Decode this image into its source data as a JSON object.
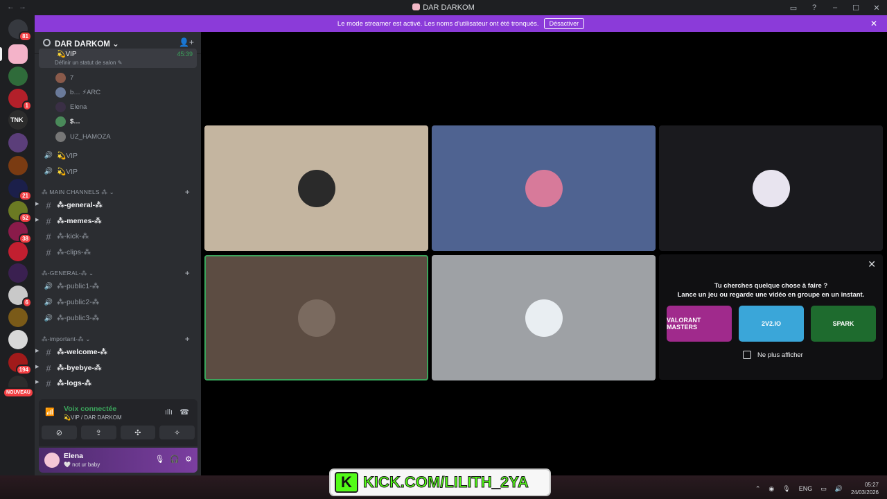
{
  "window": {
    "title": "DAR DARKOM",
    "nav_back": "←",
    "nav_forward": "→",
    "controls": [
      "▭",
      "?",
      "–",
      "☐",
      "✕"
    ]
  },
  "banner": {
    "message": "Le mode streamer est activé. Les noms d'utilisateur ont été tronqués.",
    "disable_label": "Désactiver",
    "close": "✕"
  },
  "rail": {
    "servers": [
      {
        "name": "dm",
        "color": "#36393f",
        "badge": "81"
      },
      {
        "name": "s1",
        "color": "#f4b3c9",
        "badge": "",
        "selected": true
      },
      {
        "name": "s2",
        "color": "#2f6b3a",
        "badge": ""
      },
      {
        "name": "s3",
        "color": "#b3202a",
        "badge": "1"
      },
      {
        "name": "s4",
        "color": "#2c2c2c",
        "badge": ""
      },
      {
        "name": "s5",
        "color": "#5b3e7a",
        "badge": ""
      },
      {
        "name": "s6",
        "color": "#7a3b12",
        "badge": ""
      },
      {
        "name": "s7",
        "color": "#1b1f4a",
        "badge": "21"
      },
      {
        "name": "s8",
        "color": "#6b7a23",
        "badge": "52"
      },
      {
        "name": "s9",
        "color": "#8a1b4a",
        "badge": "38"
      },
      {
        "name": "s10",
        "color": "#c21f30",
        "badge": ""
      },
      {
        "name": "s11",
        "color": "#3a2050",
        "badge": ""
      },
      {
        "name": "s12",
        "color": "#c9c9c9",
        "badge": "6"
      },
      {
        "name": "s13",
        "color": "#7a5a18",
        "badge": ""
      },
      {
        "name": "s14",
        "color": "#d8d8d8",
        "badge": ""
      },
      {
        "name": "s15",
        "color": "#a11a1a",
        "badge": "194"
      },
      {
        "name": "s16",
        "color": "#2c2c2c",
        "badge": "NOUVEAU"
      }
    ],
    "tnk_label": "TNK"
  },
  "sidebar": {
    "guild_name": "DAR DARKOM",
    "guild_chevron": "⌄",
    "invite_icon": "👤+",
    "vip_active": {
      "label": "💫VIP",
      "timer": "45:39",
      "status": "Définir un statut de salon ✎"
    },
    "voice_users": [
      {
        "name": "7",
        "color": "#8a5a4a",
        "bold": false
      },
      {
        "name": "b…  ⚡ARC",
        "color": "#6a7a9a",
        "bold": false
      },
      {
        "name": "Elena",
        "color": "#3a2f45",
        "bold": false
      },
      {
        "name": "$…",
        "color": "#4a8a5a",
        "bold": true
      },
      {
        "name": "UZ_HAMOZA",
        "color": "#777",
        "bold": false
      }
    ],
    "vip_channels": [
      "💫VIP",
      "💫VIP"
    ],
    "categories": [
      {
        "label": "⁂ MAIN CHANNELS ⁂ ⌄",
        "plus": "+"
      },
      {
        "label": "⁂-GENERAL-⁂ ⌄",
        "plus": "+"
      },
      {
        "label": "⁂-important-⁂ ⌄",
        "plus": "+"
      }
    ],
    "main_channels": [
      {
        "name": "⁂-general-⁂",
        "bright": true,
        "arrow": true
      },
      {
        "name": "⁂-memes-⁂",
        "bright": true,
        "arrow": true
      },
      {
        "name": "⁂-kick-⁂",
        "bright": false,
        "arrow": false
      },
      {
        "name": "⁂-clips-⁂",
        "bright": false,
        "arrow": false
      }
    ],
    "general_channels": [
      "⁂-public1-⁂",
      "⁂-public2-⁂",
      "⁂-public3-⁂"
    ],
    "important_channels": [
      {
        "name": "⁂-welcome-⁂",
        "bright": true
      },
      {
        "name": "⁂-byebye-⁂",
        "bright": true
      },
      {
        "name": "⁂-logs-⁂",
        "bright": true
      }
    ]
  },
  "voice_panel": {
    "title": "Voix connectée",
    "subtitle": "💫VIP / DAR DARKOM",
    "buttons": [
      "⊘",
      "⇪",
      "✣",
      "✧"
    ]
  },
  "user_panel": {
    "name": "Elena",
    "status": "🤍 not ur baby",
    "mic": "🎙",
    "headset": "🎧",
    "settings": "⚙"
  },
  "tiles": [
    {
      "bg": "#c4b5a0",
      "pfp": "#2a2a2a",
      "active": false
    },
    {
      "bg": "#4f6391",
      "pfp": "#d77a9a",
      "active": false
    },
    {
      "bg": "#1a1a1e",
      "pfp": "#e8e4ef",
      "active": false
    },
    {
      "bg": "#5c4c42",
      "pfp": "#7a6a5f",
      "active": true
    },
    {
      "bg": "#9ea1a5",
      "pfp": "#e9eef2",
      "active": false
    }
  ],
  "activity": {
    "heading": "Tu cherches quelque chose à faire ?",
    "sub": "Lance un jeu ou regarde une vidéo en groupe en un instant.",
    "cards": [
      {
        "label": "VALORANT MASTERS",
        "color": "#a02a8c"
      },
      {
        "label": "2V2.IO",
        "color": "#3aa6d9"
      },
      {
        "label": "SPARK",
        "color": "#1e6b2e"
      }
    ],
    "dont_show": "Ne plus afficher",
    "close": "✕"
  },
  "overlay": {
    "kick_logo": "K",
    "kick_text": "KICK.COM/LILITH_2YA"
  },
  "taskbar": {
    "lang": "ENG",
    "time": "05:27",
    "date": "24/03/2026"
  }
}
